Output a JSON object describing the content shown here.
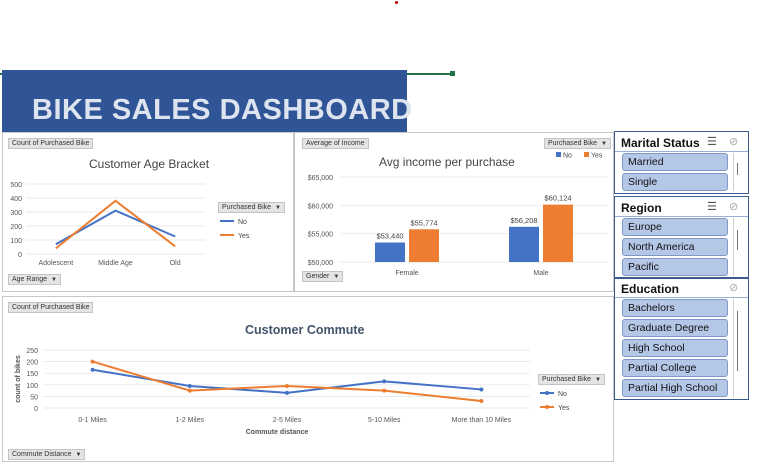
{
  "dashboard": {
    "title": "BIKE SALES DASHBOARD"
  },
  "colors": {
    "banner": "#2f5597",
    "no": "#4472c4",
    "yes": "#ed7d31",
    "slicer_item": "#b4c7e7"
  },
  "age_chart": {
    "value_button": "Count of Purchased Bike",
    "axis_button": "Age Range",
    "legend_button": "Purchased Bike",
    "chart_data": {
      "type": "line",
      "title": "Customer Age Bracket",
      "categories": [
        "Adolescent",
        "Middle Age",
        "Old"
      ],
      "series": [
        {
          "name": "No",
          "values": [
            70,
            310,
            125
          ]
        },
        {
          "name": "Yes",
          "values": [
            40,
            380,
            55
          ]
        }
      ],
      "ylim": [
        0,
        500
      ],
      "yticks": [
        0,
        100,
        200,
        300,
        400,
        500
      ],
      "legend": "right"
    }
  },
  "income_chart": {
    "value_button": "Average of Income",
    "axis_button": "Gender",
    "legend_button": "Purchased Bike",
    "chart_data": {
      "type": "bar",
      "title": "Avg income per purchase",
      "categories": [
        "Female",
        "Male"
      ],
      "series": [
        {
          "name": "No",
          "values": [
            53440,
            56208
          ]
        },
        {
          "name": "Yes",
          "values": [
            55774,
            60124
          ]
        }
      ],
      "data_labels": [
        [
          "$53,440",
          "$55,774"
        ],
        [
          "$56,208",
          "$60,124"
        ]
      ],
      "ylim": [
        50000,
        65000
      ],
      "yticks": [
        "$50,000",
        "$55,000",
        "$60,000",
        "$65,000"
      ],
      "legend": "top-right"
    }
  },
  "commute_chart": {
    "value_button": "Count of Purchased Bike",
    "axis_button": "Commute Distance",
    "legend_button": "Purchased Bike",
    "chart_data": {
      "type": "line",
      "title": "Customer Commute",
      "xlabel": "Commute distance",
      "ylabel": "count of bikes",
      "categories": [
        "0-1 Miles",
        "1-2 Miles",
        "2-5 Miles",
        "5-10 Miles",
        "More than 10 Miles"
      ],
      "series": [
        {
          "name": "No",
          "values": [
            165,
            95,
            65,
            115,
            80
          ]
        },
        {
          "name": "Yes",
          "values": [
            200,
            75,
            95,
            75,
            30
          ]
        }
      ],
      "ylim": [
        0,
        250
      ],
      "yticks": [
        0,
        50,
        100,
        150,
        200,
        250
      ],
      "legend": "right"
    }
  },
  "slicers": [
    {
      "title": "Marital Status",
      "items": [
        "Married",
        "Single"
      ]
    },
    {
      "title": "Region",
      "items": [
        "Europe",
        "North America",
        "Pacific"
      ]
    },
    {
      "title": "Education",
      "items": [
        "Bachelors",
        "Graduate Degree",
        "High School",
        "Partial College",
        "Partial High School"
      ]
    }
  ]
}
